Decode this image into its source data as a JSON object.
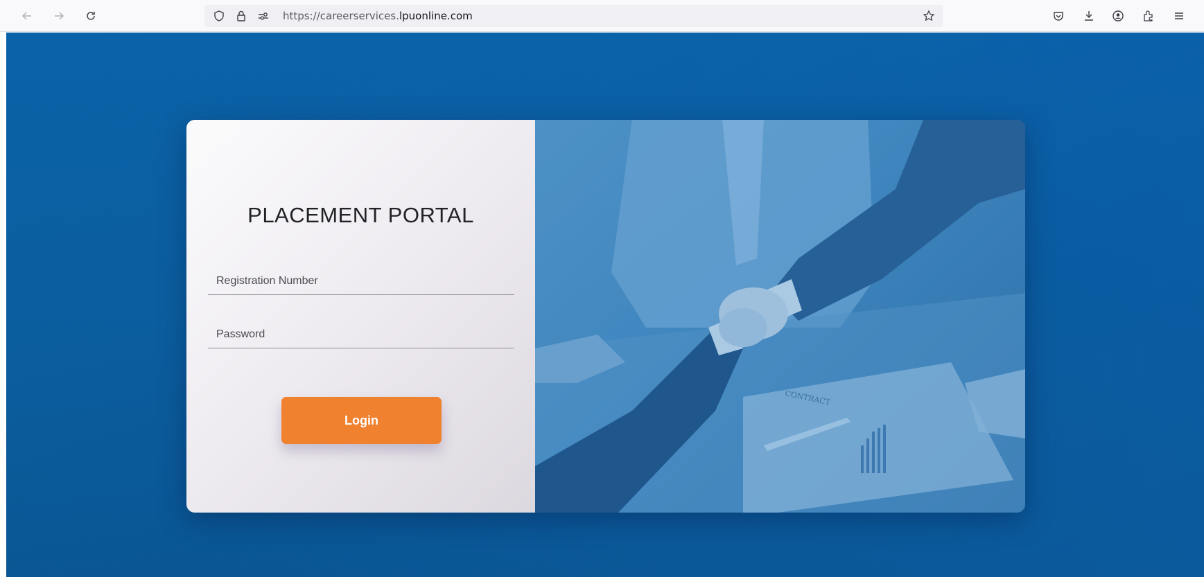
{
  "browser": {
    "url_prefix": "https://careerservices.",
    "url_domain": "lpuonline.com",
    "icons": [
      "back-arrow-icon",
      "forward-arrow-icon",
      "reload-icon",
      "shield-icon",
      "lock-icon",
      "permissions-icon",
      "bookmark-star-icon",
      "pocket-icon",
      "download-icon",
      "account-icon",
      "extensions-icon",
      "menu-icon"
    ]
  },
  "login": {
    "title": "PLACEMENT PORTAL",
    "registration_placeholder": "Registration Number",
    "password_placeholder": "Password",
    "login_label": "Login"
  },
  "colors": {
    "page_background": "#0a5a9a",
    "login_button": "#f0812f",
    "image_tint": "#3f88c2"
  },
  "hero_image": {
    "subject": "business handshake",
    "contract_text": "CONTRACT"
  }
}
